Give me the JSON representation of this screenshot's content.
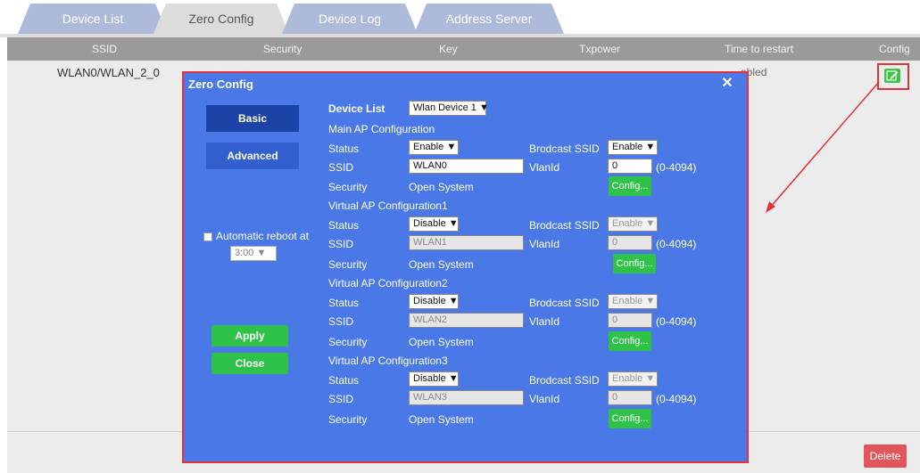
{
  "tabs": [
    "Device List",
    "Zero Config",
    "Device Log",
    "Address Server"
  ],
  "table": {
    "columns": [
      "SSID",
      "Security",
      "Key",
      "Txpower",
      "Time to restart",
      "Config"
    ],
    "row": {
      "ssid": "WLAN0/WLAN_2_0",
      "status_fragment": "abled"
    }
  },
  "delete_label": "Delete",
  "modal": {
    "title": "Zero Config",
    "close_symbol": "✕",
    "basic_label": "Basic",
    "advanced_label": "Advanced",
    "reboot_label": "Automatic reboot at",
    "reboot_time": "3:00",
    "apply_label": "Apply",
    "close_label": "Close",
    "device_list_label": "Device List",
    "device_list_value": "Wlan Device 1",
    "sections": [
      {
        "title": "Main AP Configuration",
        "status": "Enable",
        "ssid": "WLAN0",
        "broadcast": "Enable",
        "vlan": "0"
      },
      {
        "title": "Virtual AP Configuration1",
        "status": "Disable",
        "ssid": "WLAN1",
        "broadcast": "Enable",
        "vlan": "0"
      },
      {
        "title": "Virtual AP Configuration2",
        "status": "Disable",
        "ssid": "WLAN2",
        "broadcast": "Enable",
        "vlan": "0"
      },
      {
        "title": "Virtual AP Configuration3",
        "status": "Disable",
        "ssid": "WLAN3",
        "broadcast": "Enable",
        "vlan": "0"
      }
    ],
    "labels": {
      "status": "Status",
      "ssid": "SSID",
      "security": "Security",
      "security_value": "Open System",
      "broadcast": "Brodcast SSID",
      "vlan": "VlanId",
      "vlan_range": "(0-4094)",
      "config_button": "Config..."
    }
  },
  "colors": {
    "modal_bg": "#4a78e6",
    "highlight": "#e0333a",
    "green": "#2ec248"
  }
}
